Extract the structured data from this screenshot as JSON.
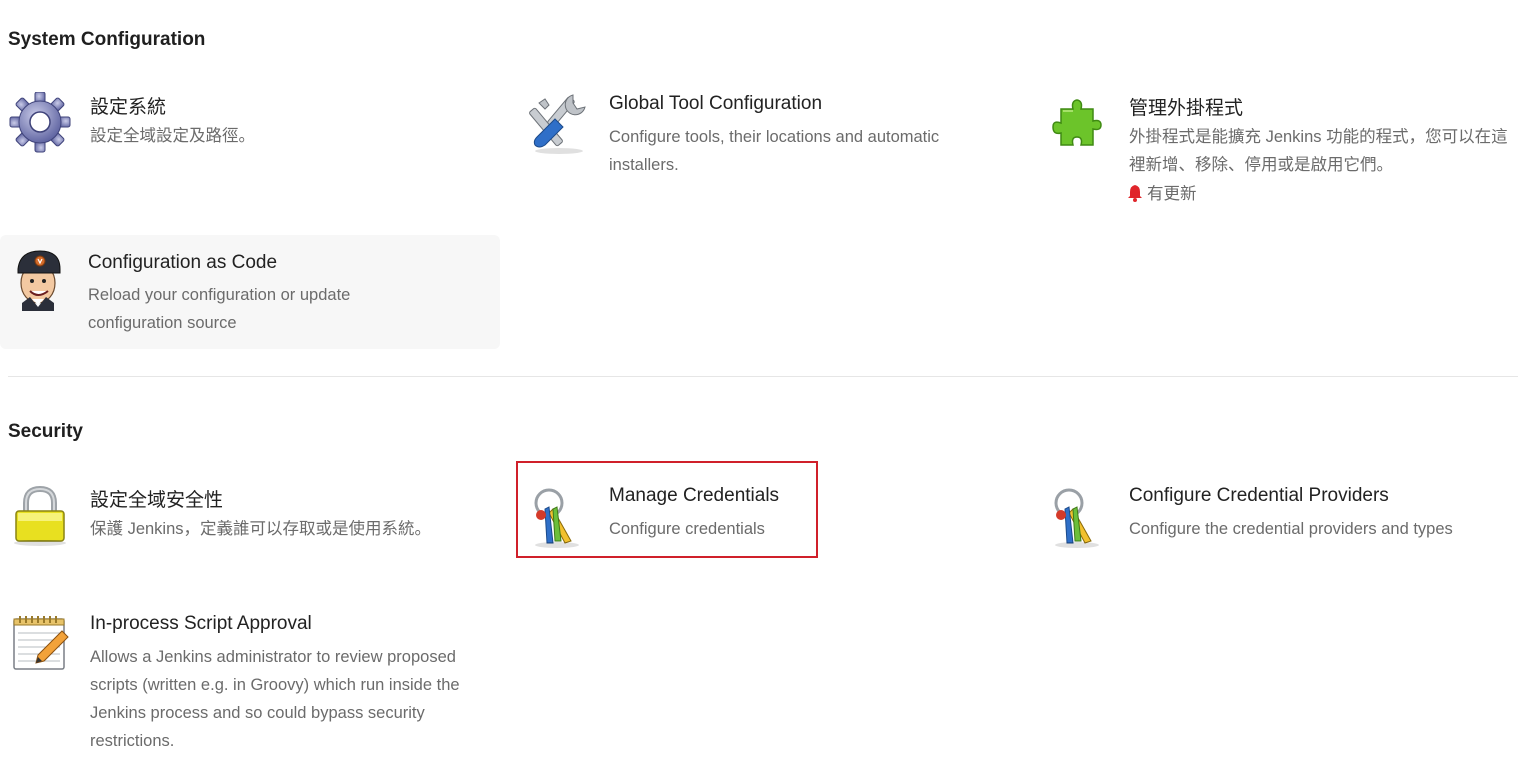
{
  "sections": {
    "system": {
      "title": "System Configuration",
      "items": [
        {
          "title": "設定系統",
          "desc": "設定全域設定及路徑。",
          "icon": "gear-icon"
        },
        {
          "title": "Global Tool Configuration",
          "desc": "Configure tools, their locations and automatic installers.",
          "icon": "tools-icon"
        },
        {
          "title": "管理外掛程式",
          "desc": "外掛程式是能擴充 Jenkins 功能的程式，您可以在這裡新增、移除、停用或是啟用它們。",
          "badge": "有更新",
          "icon": "puzzle-icon"
        },
        {
          "title": "Configuration as Code",
          "desc": "Reload your configuration or update configuration source",
          "icon": "jenkins-butler-icon"
        }
      ]
    },
    "security": {
      "title": "Security",
      "items": [
        {
          "title": "設定全域安全性",
          "desc": "保護 Jenkins，定義誰可以存取或是使用系統。",
          "icon": "padlock-icon"
        },
        {
          "title": "Manage Credentials",
          "desc": "Configure credentials",
          "icon": "keys-icon"
        },
        {
          "title": "Configure Credential Providers",
          "desc": "Configure the credential providers and types",
          "icon": "keys-icon"
        },
        {
          "title": "In-process Script Approval",
          "desc": "Allows a Jenkins administrator to review proposed scripts (written e.g. in Groovy) which run inside the Jenkins process and so could bypass security restrictions.",
          "icon": "notepad-icon"
        }
      ]
    }
  },
  "colors": {
    "highlight_border": "#d0202a",
    "bell": "#e0252b"
  }
}
